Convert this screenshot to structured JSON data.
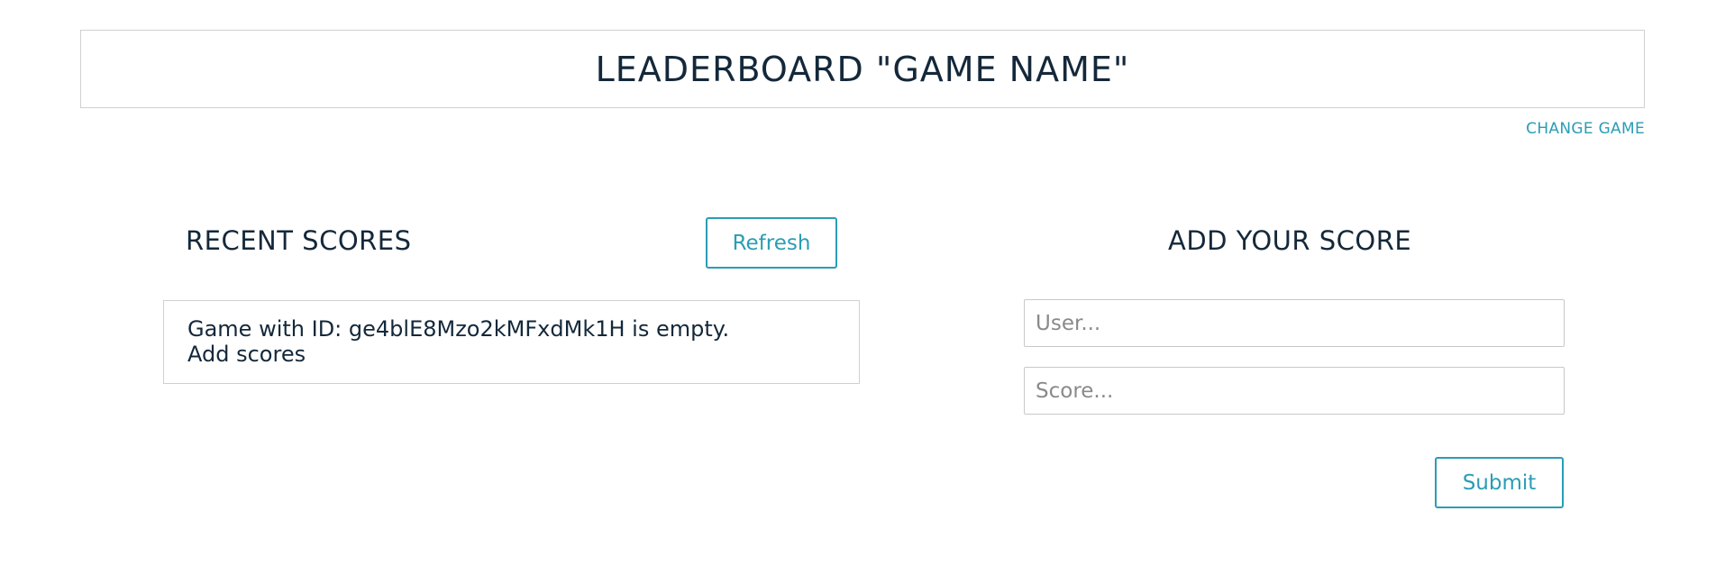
{
  "header": {
    "title": "LEADERBOARD \"GAME NAME\"",
    "change_game_label": "CHANGE GAME"
  },
  "recent_scores": {
    "heading": "RECENT SCORES",
    "refresh_label": "Refresh",
    "message_line1": "Game with ID: ge4blE8Mzo2kMFxdMk1H is empty.",
    "message_line2": "Add scores"
  },
  "add_score": {
    "heading": "ADD YOUR SCORE",
    "user_placeholder": "User...",
    "score_placeholder": "Score...",
    "submit_label": "Submit"
  },
  "colors": {
    "accent": "#2a9db5",
    "text": "#14283a",
    "border": "#d0d0d0"
  }
}
